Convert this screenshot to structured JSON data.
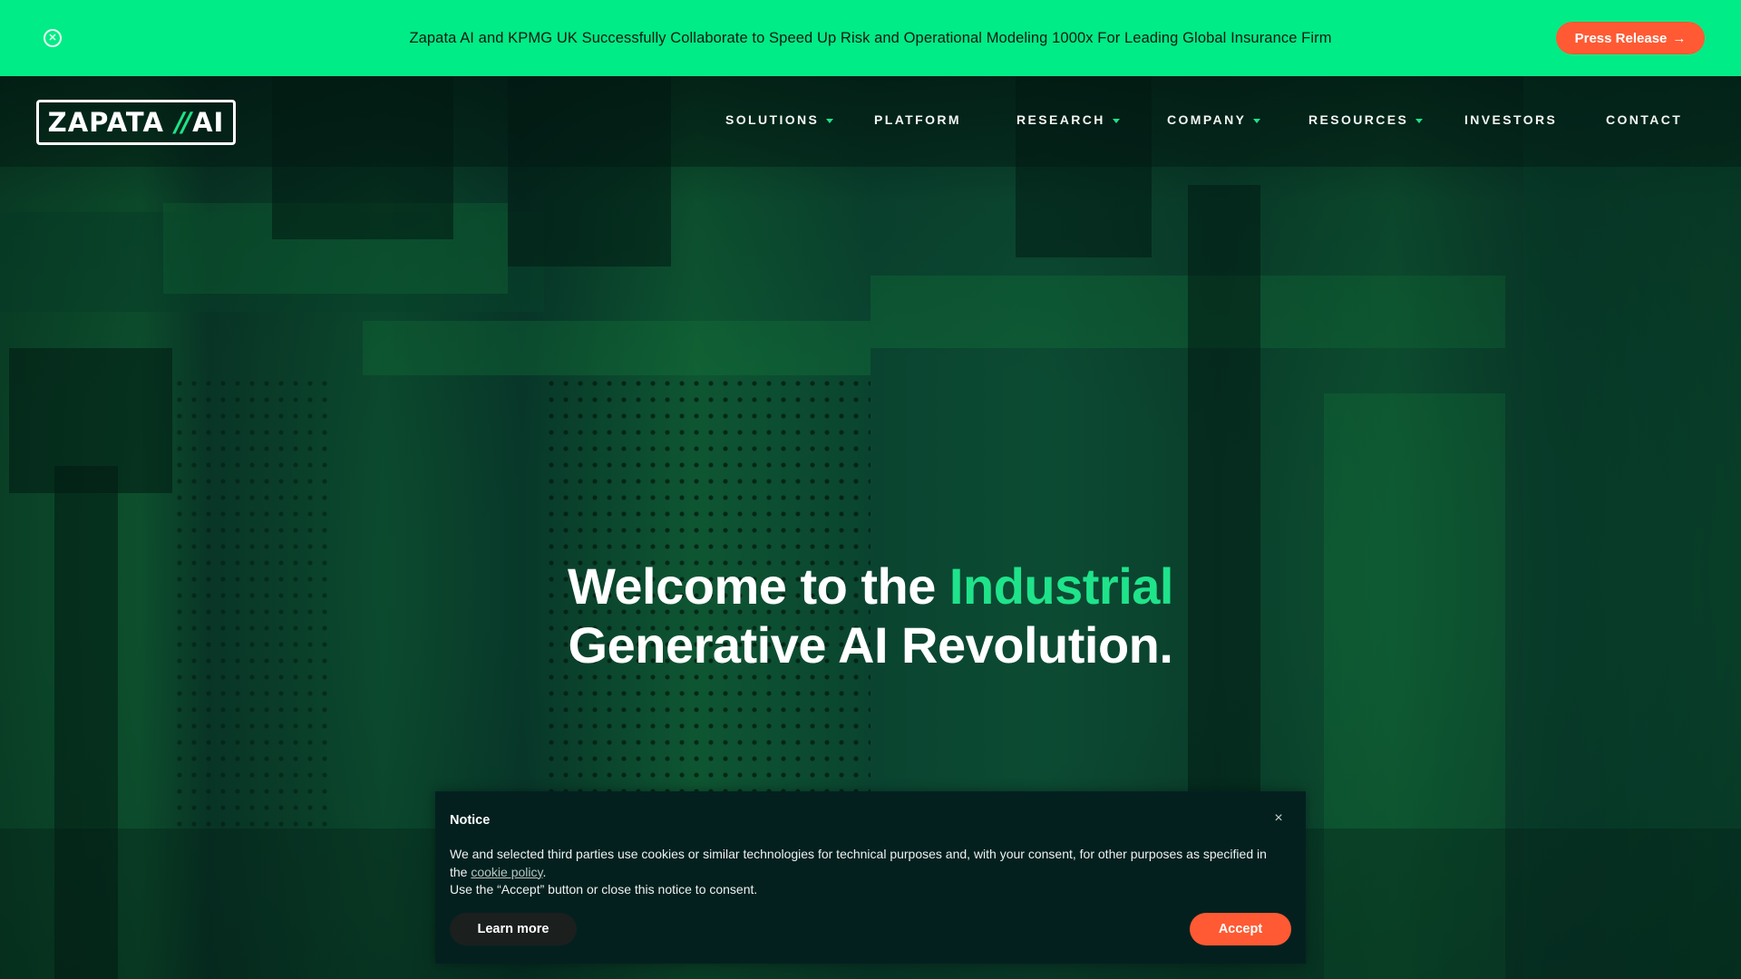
{
  "banner": {
    "close_icon": "circle-x-icon",
    "text": "Zapata AI and KPMG UK Successfully Collaborate to Speed Up Risk and Operational Modeling 1000x For Leading Global Insurance Firm",
    "button_label": "Press Release",
    "button_icon": "→",
    "colors": {
      "background": "#00ec86",
      "button": "#ff5a33"
    }
  },
  "logo": {
    "word": "ZAPATA",
    "slashes": "//",
    "suffix": "AI",
    "accent_color": "#1ee388"
  },
  "nav": {
    "items": [
      {
        "label": "SOLUTIONS",
        "has_dropdown": true
      },
      {
        "label": "PLATFORM",
        "has_dropdown": false
      },
      {
        "label": "RESEARCH",
        "has_dropdown": true
      },
      {
        "label": "COMPANY",
        "has_dropdown": true
      },
      {
        "label": "RESOURCES",
        "has_dropdown": true
      },
      {
        "label": "INVESTORS",
        "has_dropdown": false
      },
      {
        "label": "CONTACT",
        "has_dropdown": false
      }
    ]
  },
  "hero": {
    "headline_part1": "Welcome to the ",
    "headline_accent": "Industrial",
    "headline_line2": "Generative AI Revolution.",
    "accent_color": "#1fe38a"
  },
  "cookie_notice": {
    "title": "Notice",
    "close_icon": "×",
    "text_before_link": "We and selected third parties use cookies or similar technologies for technical purposes and, with your consent, for other purposes as specified in the ",
    "link_text": "cookie policy",
    "text_after_link": ".",
    "text_line2": "Use the “Accept” button or close this notice to consent.",
    "learn_more_label": "Learn more",
    "accept_label": "Accept"
  }
}
